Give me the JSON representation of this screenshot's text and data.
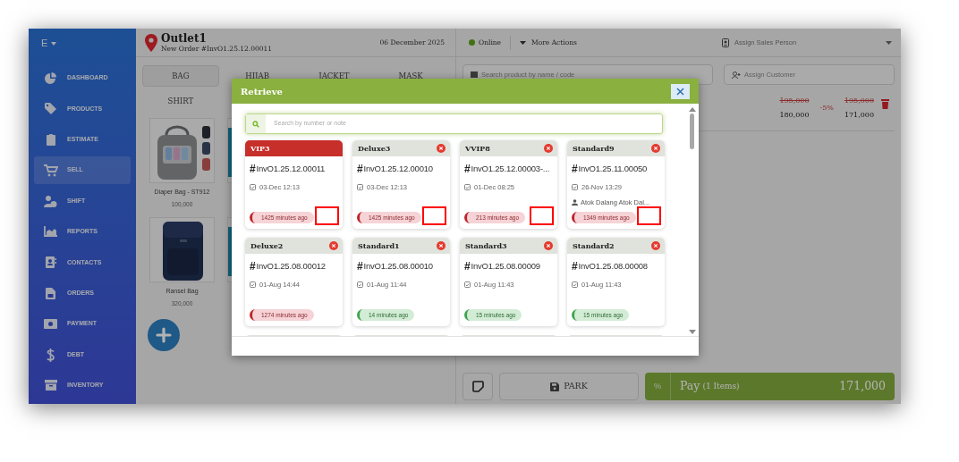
{
  "sidebar": {
    "brand": "E",
    "items": [
      {
        "label": "DASHBOARD",
        "selected": false
      },
      {
        "label": "PRODUCTS",
        "selected": false
      },
      {
        "label": "ESTIMATE",
        "selected": false
      },
      {
        "label": "SELL",
        "selected": true
      },
      {
        "label": "SHIFT",
        "selected": false
      },
      {
        "label": "REPORTS",
        "selected": false
      },
      {
        "label": "CONTACTS",
        "selected": false
      },
      {
        "label": "ORDERS",
        "selected": false
      },
      {
        "label": "PAYMENT",
        "selected": false
      },
      {
        "label": "DEBT",
        "selected": false
      },
      {
        "label": "INVENTORY",
        "selected": false
      }
    ]
  },
  "order_header": {
    "outlet": "Outlet1",
    "order": "New Order #InvO1.25.12.00011",
    "date": "06 December 2025"
  },
  "categories": [
    {
      "label": "BAG",
      "selected": true
    },
    {
      "label": "HIJAB",
      "selected": false
    },
    {
      "label": "JACKET",
      "selected": false
    },
    {
      "label": "MASK",
      "selected": false
    },
    {
      "label": "SHIRT",
      "selected": false
    }
  ],
  "products": [
    {
      "name": "Diaper Bag - ST912",
      "price": "100,000",
      "kind": "gray-bag"
    },
    {
      "kind": "teal-item"
    },
    {
      "name": "Ransel Bag",
      "price": "320,000",
      "kind": "navy-bag"
    },
    {
      "kind": "teal-item"
    }
  ],
  "toolbar": {
    "status": "Online",
    "online": true,
    "more_actions": "More Actions",
    "sales_person": "Assign Sales Person"
  },
  "search_product": {
    "placeholder": "Search product by name / code"
  },
  "customer": {
    "placeholder": "Assign Customer"
  },
  "cart": [
    {
      "original_price": "195,000",
      "price": "180,000",
      "discount": "-5%",
      "original_total": "195,000",
      "total": "171,000"
    }
  ],
  "footer": {
    "park": "PARK",
    "discount": "%",
    "pay": "Pay",
    "pay_count": "(1 Items)",
    "pay_total": "171,000"
  },
  "modal": {
    "title": "Retrieve",
    "search": {
      "placeholder": "Search by number or note"
    },
    "orders": [
      {
        "kind": "order",
        "label": "VIP3",
        "current": true,
        "mark": "#",
        "number": "InvO1.25.12.00011",
        "date": "03-Dec 12:13",
        "age": "1425 minutes ago",
        "overdue": true,
        "highlighted": true
      },
      {
        "kind": "order",
        "label": "Deluxe3",
        "current": false,
        "mark": "#",
        "number": "InvO1.25.12.00010",
        "date": "03-Dec 12:13",
        "age": "1425 minutes ago",
        "overdue": true,
        "highlighted": true
      },
      {
        "kind": "order",
        "label": "VVIP8",
        "current": false,
        "mark": "#",
        "number": "InvO1.25.12.00003-...",
        "date": "01-Dec 08:25",
        "age": "213 minutes ago",
        "overdue": true,
        "highlighted": true
      },
      {
        "kind": "order",
        "label": "Standard9",
        "current": false,
        "mark": "#",
        "number": "InvO1.25.11.00050",
        "date": "26-Nov 13:29",
        "customer": "Atok Dalang Atok Dal...",
        "age": "1349 minutes ago",
        "overdue": true,
        "highlighted": true
      },
      {
        "kind": "order",
        "label": "Deluxe2",
        "current": false,
        "mark": "#",
        "number": "InvO1.25.08.00012",
        "date": "01-Aug 14:44",
        "age": "1274 minutes ago",
        "overdue": true,
        "highlighted": false
      },
      {
        "kind": "order",
        "label": "Standard1",
        "current": false,
        "mark": "#",
        "number": "InvO1.25.08.00010",
        "date": "01-Aug 11:44",
        "age": "14 minutes ago",
        "overdue": false,
        "highlighted": false
      },
      {
        "kind": "order",
        "label": "Standard3",
        "current": false,
        "mark": "#",
        "number": "InvO1.25.08.00009",
        "date": "01-Aug 11:43",
        "age": "15 minutes ago",
        "overdue": false,
        "highlighted": false
      },
      {
        "kind": "order",
        "label": "Standard2",
        "current": false,
        "mark": "#",
        "number": "InvO1.25.08.00008",
        "date": "01-Aug 11:43",
        "age": "15 minutes ago",
        "overdue": false,
        "highlighted": false
      },
      {
        "kind": "partial"
      },
      {
        "kind": "partial"
      },
      {
        "kind": "partial"
      },
      {
        "kind": "partial"
      }
    ]
  }
}
